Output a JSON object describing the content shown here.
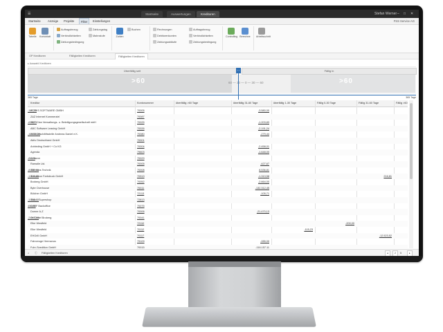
{
  "titlebar": {
    "tabs": [
      "Startseite",
      "Auswertungen",
      "Kreditoren"
    ],
    "active_tab": 2,
    "user": "Stefan Werner",
    "window_controls": [
      "minimize-icon",
      "maximize-icon",
      "close-icon"
    ]
  },
  "menu": {
    "items": [
      "Startseite",
      "Anzeige",
      "Projekte",
      "Filter",
      "Einstellungen"
    ],
    "active_index": 3,
    "company": "FSS Service AG"
  },
  "ribbon": {
    "large_buttons": [
      "Tabelle",
      "Kontoblatt"
    ],
    "group1": [
      "Auftragsbezug",
      "Verbindlichkeiten",
      "Zahlungsbedingung"
    ],
    "group2": [
      "Zahlungstag",
      "Mahnstufe"
    ],
    "group3": [
      "Zahlen",
      "Buchen"
    ],
    "group4": [
      "Rechnungen",
      "Debitorenkonten",
      "Zahlungsabläufe"
    ],
    "large_buttons2": [
      "Controlling",
      "Berechne",
      "Arbeitsschritt"
    ],
    "accent_color": "#2f6fb3"
  },
  "subtabs": [
    "OP Kreditoren",
    "Fälligkeiten Kreditoren",
    "Fälligkeiten Kreditoren"
  ],
  "filterbar": "Auswahl Kreditoren",
  "timeline": {
    "left_label": "Überfällig seit",
    "right_label": "Fällig in",
    "mid_marker": "0",
    "band_left": ">60",
    "band_right": ">60",
    "mid_values": "60 — 30 — 0 — 30 — 60",
    "foot_left": "365 Tage",
    "foot_right": "365 Tage"
  },
  "grid": {
    "columns": [
      "Kreditor",
      "Kontonummer",
      "überfällig >60 Tage",
      "überfällig 31-60 Tage",
      "überfällig 1-30 Tage",
      "Fällig 0-30 Tage",
      "Fällig 31-60 Tage",
      "Fällig >60 Tage"
    ],
    "rows": [
      {
        "name": "ACSYS SOFTWARE GMBH",
        "kto": "70005",
        "v": [
          "",
          "-3.580,00",
          "",
          "",
          "",
          "",
          "-157,25"
        ]
      },
      {
        "name": "Z&Z Internet Kommerziel",
        "kto": "70087",
        "v": [
          "",
          "",
          "",
          "",
          "",
          "",
          ""
        ]
      },
      {
        "name": "ABC Clea Verwaltungs- u. Beteiligungsgesellschaft mbH",
        "kto": "70025",
        "v": [
          "",
          "-1.203,83",
          "",
          "",
          "",
          "",
          "-678,73"
        ]
      },
      {
        "name": "ABC Software Leasing GmbH",
        "kto": "70026",
        "v": [
          "",
          "-2.191,24",
          "",
          "",
          "",
          "",
          ""
        ]
      },
      {
        "name": "AKA Geschäftsstelle Andreas Daniel e.K.",
        "kto": "70080",
        "v": [
          "",
          "-279,44",
          "",
          "",
          "",
          "",
          "-10.036,20"
        ]
      },
      {
        "name": "Aktiv Deutschland GmbH",
        "kto": "70001",
        "v": [
          "",
          "",
          "",
          "",
          "",
          "",
          ""
        ]
      },
      {
        "name": "Anbieding GmbH + Co KG",
        "kto": "70004",
        "v": [
          "",
          "-2.458,01",
          "",
          "",
          "",
          "",
          ""
        ]
      },
      {
        "name": "Agenda",
        "kto": "79603",
        "v": [
          "",
          "-1.648,00",
          "",
          "",
          "",
          "",
          ""
        ]
      },
      {
        "name": "Amazon",
        "kto": "70029",
        "v": [
          "",
          "",
          "",
          "",
          "",
          "",
          "-81,78"
        ]
      },
      {
        "name": "Ramalle Ltd.",
        "kto": "70005",
        "v": [
          "",
          "-427,67",
          "",
          "",
          "",
          "",
          ""
        ]
      },
      {
        "name": "Bittecons Technik",
        "kto": "70008",
        "v": [
          "",
          "8.536,81",
          "",
          "",
          "",
          "",
          "-8.737,96"
        ]
      },
      {
        "name": "Brennicon Farbdruck GmbH",
        "kto": "70913",
        "v": [
          "",
          "-1.313,58",
          "",
          "",
          "216,81",
          "",
          "-1.101,60"
        ]
      },
      {
        "name": "Broberg GmbH",
        "kto": "70052",
        "v": [
          "",
          "-2.664,00",
          "",
          "",
          "",
          "",
          ""
        ]
      },
      {
        "name": "Byte Overhouse",
        "kto": "70011",
        "v": [
          "",
          "-132.312,45",
          "",
          "",
          "",
          "",
          ""
        ]
      },
      {
        "name": "Bölcher GmbH",
        "kto": "72113",
        "v": [
          "",
          "-105,71",
          "",
          "",
          "",
          "",
          ""
        ]
      },
      {
        "name": "Bako - Supershop",
        "kto": "72813",
        "v": [
          "",
          "",
          "",
          "",
          "",
          "",
          "-1.752,00"
        ]
      },
      {
        "name": "CHEF Backoffice",
        "kto": "70075",
        "v": [
          "",
          "",
          "",
          "",
          "",
          "",
          "455,00"
        ]
      },
      {
        "name": "Dorner A-Z",
        "kto": "70006",
        "v": [
          "",
          "-21.470,13",
          "",
          "",
          "",
          "",
          ""
        ]
      },
      {
        "name": "Dr. Detlef Broberg",
        "kto": "70041",
        "v": [
          "",
          "",
          "",
          "",
          "",
          "",
          "-2.605,00"
        ]
      },
      {
        "name": "Elke Westfeld",
        "kto": "72110",
        "v": [
          "",
          "",
          "",
          "-200,00",
          "",
          "",
          ""
        ]
      },
      {
        "name": "Elke Westfeld",
        "kto": "70112",
        "v": [
          "",
          "",
          "-115,23",
          "",
          "",
          "",
          ""
        ]
      },
      {
        "name": "EHGrill GmbH",
        "kto": "70117",
        "v": [
          "",
          "",
          "",
          "",
          "-12.523,52",
          "",
          ""
        ]
      },
      {
        "name": "Fahrzeuge Hermanus",
        "kto": "79109",
        "v": [
          "",
          "-285,00",
          "",
          "",
          "",
          "",
          ""
        ]
      },
      {
        "name": "Fuhr-Spedition GmbH",
        "kto": "70015",
        "v": [
          "",
          "-116.157,11",
          "",
          "",
          "",
          "",
          ""
        ]
      }
    ]
  },
  "statusbar": {
    "text": "Fälligkeiten Kreditoren",
    "page_current": "2",
    "page_total": "5"
  }
}
